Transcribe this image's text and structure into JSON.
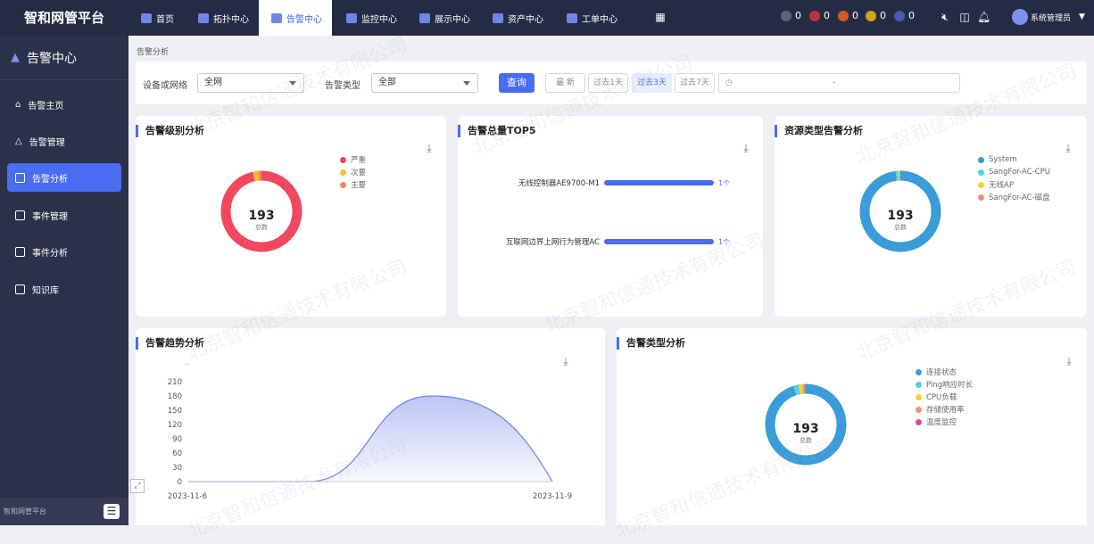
{
  "app_title": "智和网管平台",
  "nav": {
    "items": [
      {
        "label": "首页",
        "icon": "home-icon"
      },
      {
        "label": "拓扑中心",
        "icon": "topology-icon"
      },
      {
        "label": "告警中心",
        "icon": "alert-icon",
        "active": true
      },
      {
        "label": "监控中心",
        "icon": "monitor-icon"
      },
      {
        "label": "展示中心",
        "icon": "display-icon"
      },
      {
        "label": "资产中心",
        "icon": "asset-icon"
      },
      {
        "label": "工单中心",
        "icon": "ticket-icon"
      }
    ],
    "apps_icon": "grid-icon"
  },
  "alert_counts": [
    {
      "value": "0",
      "color": "#5a6280"
    },
    {
      "value": "0",
      "color": "#c0303a"
    },
    {
      "value": "0",
      "color": "#d45a2a"
    },
    {
      "value": "0",
      "color": "#d4a020"
    },
    {
      "value": "0",
      "color": "#4a5ab0"
    }
  ],
  "user": {
    "name": "系统管理员"
  },
  "sidebar": {
    "title": "告警中心",
    "items": [
      {
        "label": "告警主页",
        "icon": "home-icon"
      },
      {
        "label": "告警管理",
        "icon": "bell-icon"
      },
      {
        "label": "告警分析",
        "icon": "chart-icon",
        "active": true
      },
      {
        "label": "事件管理",
        "icon": "clipboard-icon"
      },
      {
        "label": "事件分析",
        "icon": "chart-icon"
      },
      {
        "label": "知识库",
        "icon": "book-icon"
      }
    ],
    "footer": "智和网管平台"
  },
  "breadcrumb": "告警分析",
  "filters": {
    "device_label": "设备或网络",
    "device_value": "全网",
    "type_label": "告警类型",
    "type_value": "全部",
    "query_button": "查询",
    "time_buttons": [
      "最 新",
      "过去1天",
      "过去3天",
      "过去7天"
    ],
    "active_time": "过去3天",
    "date_separator": "-"
  },
  "accent_color": "#4a6cf0",
  "watermark": "北京智和信通技术有限公司",
  "cards": {
    "level": {
      "title": "告警级别分析",
      "total": "193",
      "total_label": "总数",
      "legend": [
        "严重",
        "次要",
        "主要"
      ]
    },
    "top5": {
      "title": "告警总量TOP5"
    },
    "resource": {
      "title": "资源类型告警分析",
      "total": "193",
      "total_label": "总数",
      "legend": [
        "System",
        "SangFor-AC-CPU",
        "无线AP",
        "SangFor-AC-磁盘"
      ]
    },
    "trend": {
      "title": "告警趋势分析"
    },
    "type": {
      "title": "告警类型分析",
      "total": "193",
      "total_label": "总数",
      "legend": [
        "连接状态",
        "Ping响应时长",
        "CPU负载",
        "存储使用率",
        "温度监控"
      ]
    }
  },
  "chart_data": [
    {
      "type": "pie",
      "title": "告警级别分析",
      "labels": [
        "严重",
        "次要",
        "主要"
      ],
      "values": [
        186,
        4,
        3
      ],
      "colors": [
        "#f0485e",
        "#f5bd35",
        "#f08a4b"
      ]
    },
    {
      "type": "bar",
      "title": "告警总量TOP5",
      "categories": [
        "无线控制器AE9700-M1",
        "互联网边界上网行为管理AC"
      ],
      "values": [
        1,
        1
      ],
      "data_labels": [
        "1个",
        "1个"
      ],
      "color": "#4a6cf0"
    },
    {
      "type": "pie",
      "title": "资源类型告警分析",
      "labels": [
        "System",
        "SangFor-AC-CPU",
        "无线AP",
        "SangFor-AC-磁盘"
      ],
      "values": [
        189,
        2,
        1,
        1
      ],
      "colors": [
        "#3a9cd8",
        "#4cd4e0",
        "#f5d035",
        "#f0907a"
      ]
    },
    {
      "type": "area",
      "title": "告警趋势分析",
      "x": [
        "2023-11-6",
        "2023-11-7",
        "2023-11-8",
        "2023-11-9"
      ],
      "values": [
        0,
        0,
        180,
        0
      ],
      "yticks": [
        "0",
        "30",
        "60",
        "90",
        "120",
        "150",
        "180",
        "210"
      ],
      "ylim": [
        0,
        210
      ],
      "xtick_labels": [
        "2023-11-6",
        "2023-11-9"
      ],
      "color": "#6d7fe8"
    },
    {
      "type": "pie",
      "title": "告警类型分析",
      "labels": [
        "连接状态",
        "Ping响应时长",
        "CPU负载",
        "存储使用率",
        "温度监控"
      ],
      "values": [
        183,
        4,
        3,
        2,
        1
      ],
      "colors": [
        "#3a9cd8",
        "#4cd4e0",
        "#f5d035",
        "#f0907a",
        "#d94aa8"
      ]
    }
  ]
}
